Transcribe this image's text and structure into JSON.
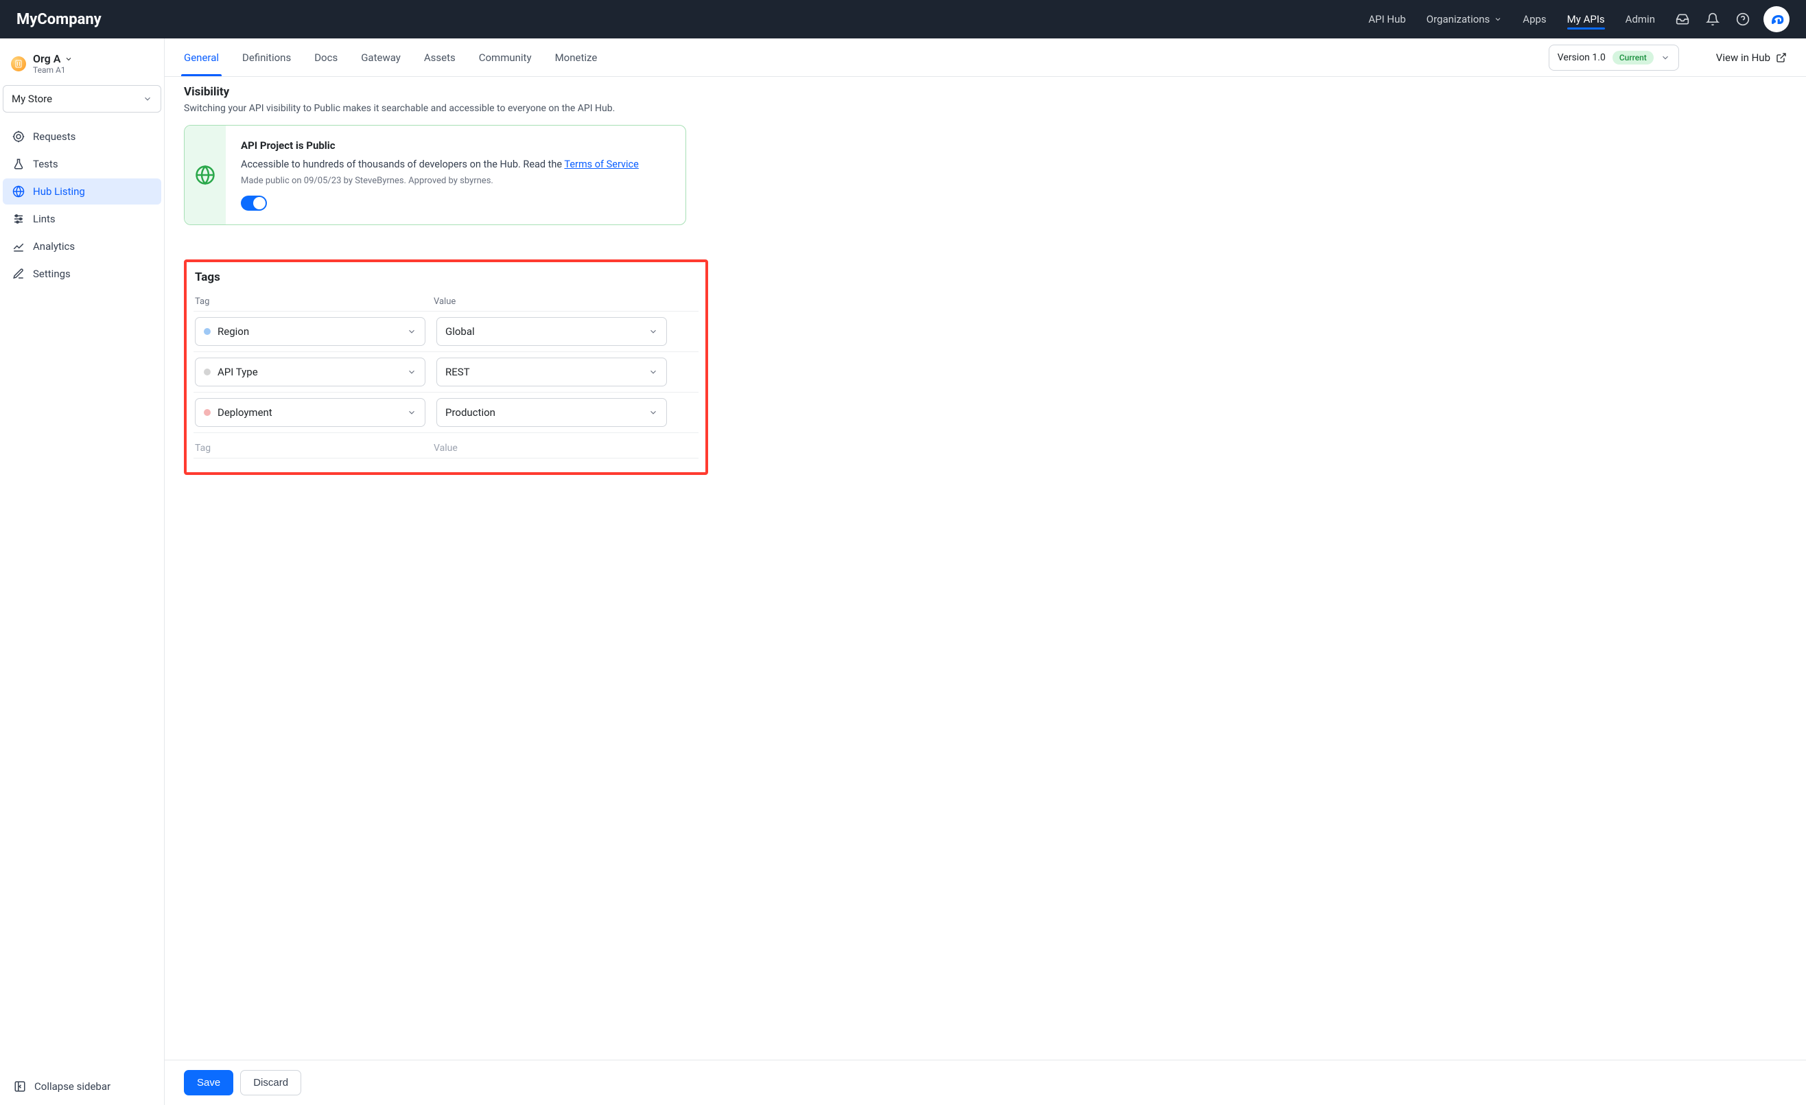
{
  "brand": "MyCompany",
  "topnav": {
    "items": [
      "API Hub",
      "Organizations",
      "Apps",
      "My APIs",
      "Admin"
    ],
    "active_index": 3,
    "dropdown_indices": [
      1
    ]
  },
  "sidebar": {
    "org_name": "Org A",
    "team_name": "Team A1",
    "store_label": "My Store",
    "items": [
      {
        "label": "Requests",
        "icon": "target"
      },
      {
        "label": "Tests",
        "icon": "flask"
      },
      {
        "label": "Hub Listing",
        "icon": "globe"
      },
      {
        "label": "Lints",
        "icon": "sliders"
      },
      {
        "label": "Analytics",
        "icon": "chart"
      },
      {
        "label": "Settings",
        "icon": "pencil"
      }
    ],
    "active_index": 2,
    "collapse_label": "Collapse sidebar"
  },
  "tabs": {
    "items": [
      "General",
      "Definitions",
      "Docs",
      "Gateway",
      "Assets",
      "Community",
      "Monetize"
    ],
    "active_index": 0,
    "version_label": "Version 1.0",
    "current_badge": "Current",
    "view_in_hub": "View in Hub"
  },
  "visibility": {
    "title": "Visibility",
    "subtitle": "Switching your API visibility to Public makes it searchable and accessible to everyone on the API Hub.",
    "card_title": "API Project is Public",
    "card_text_prefix": "Accessible to hundreds of thousands of developers on the Hub. Read the ",
    "card_link": "Terms of Service",
    "meta": "Made public on 09/05/23 by SteveByrnes. Approved by sbyrnes.",
    "toggled_on": true
  },
  "tags": {
    "title": "Tags",
    "header_tag": "Tag",
    "header_value": "Value",
    "rows": [
      {
        "tag": "Region",
        "value": "Global",
        "dot_color": "#9ec8f5"
      },
      {
        "tag": "API Type",
        "value": "REST",
        "dot_color": "#d4d4d4"
      },
      {
        "tag": "Deployment",
        "value": "Production",
        "dot_color": "#f5b4b4"
      }
    ],
    "placeholder_tag": "Tag",
    "placeholder_value": "Value"
  },
  "footer": {
    "save": "Save",
    "discard": "Discard"
  }
}
